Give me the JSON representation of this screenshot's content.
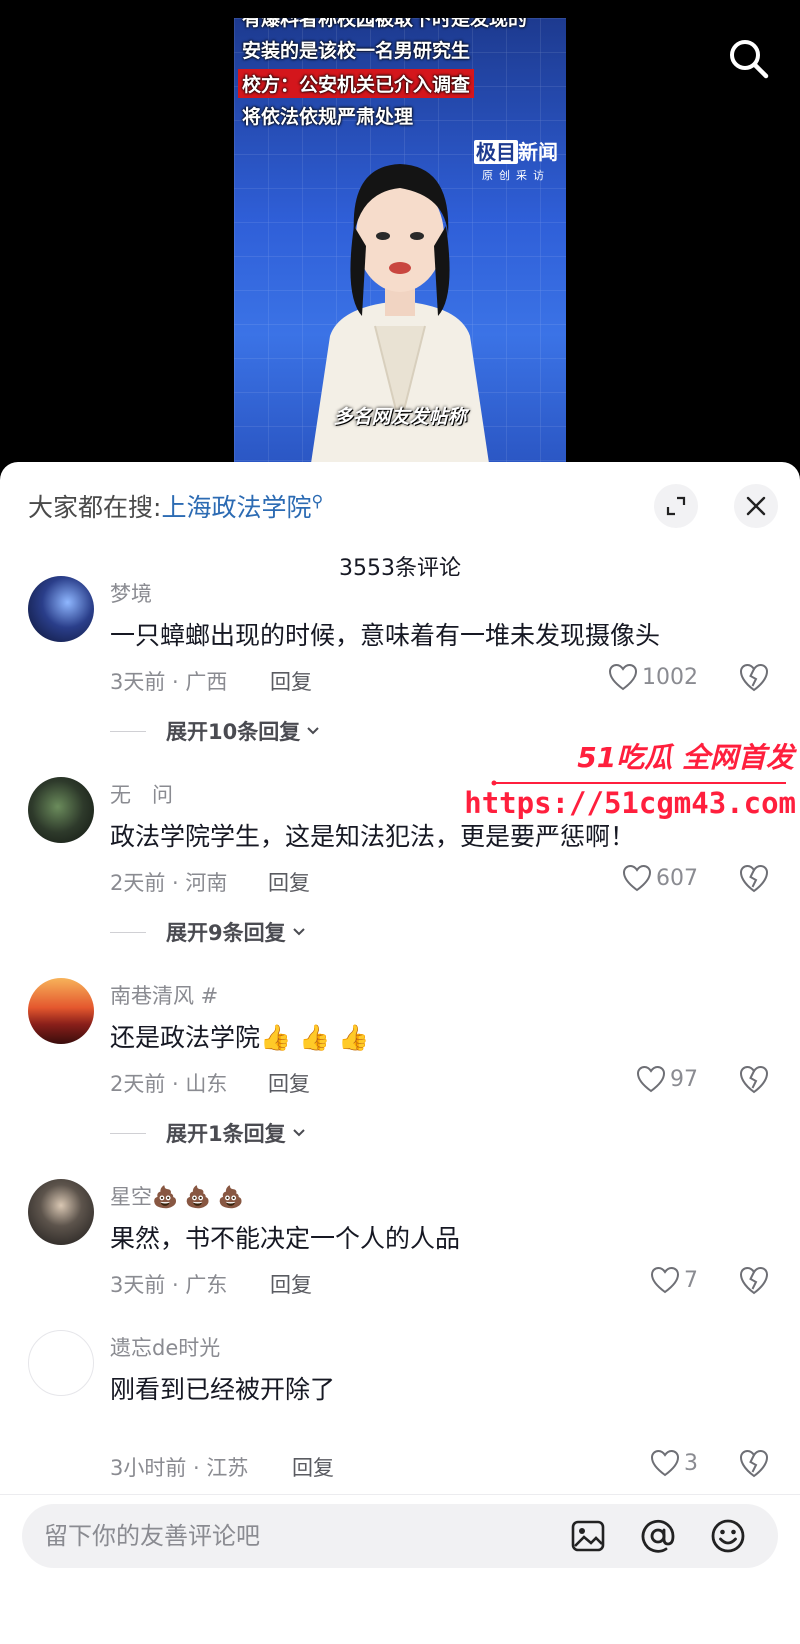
{
  "video": {
    "captions": [
      "有爆料者称校园被取下时是发现的",
      "安装的是该校一名男研究生",
      "校方：公安机关已介入调查",
      "将依法依规严肃处理"
    ],
    "logo_brand_box": "极目",
    "logo_brand_rest": "新闻",
    "logo_sub": "原创采访",
    "subtitle": "多名网友发帖称"
  },
  "sheet": {
    "hot_search_prefix": "大家都在搜:",
    "hot_search_keyword": "上海政法学院",
    "comment_count": "3553条评论"
  },
  "comments": [
    {
      "username": "梦境",
      "content": "一只蟑螂出现的时候，意味着有一堆未发现摄像头",
      "meta": "3天前 · 广西",
      "reply": "回复",
      "likes": "1002",
      "expand": "展开10条回复"
    },
    {
      "username": "无　问",
      "content": "政法学院学生，这是知法犯法，更是要严惩啊！",
      "meta": "2天前 · 河南",
      "reply": "回复",
      "likes": "607",
      "expand": "展开9条回复"
    },
    {
      "username": "南巷清风 #",
      "content": "还是政法学院👍 👍 👍",
      "meta": "2天前 · 山东",
      "reply": "回复",
      "likes": "97",
      "expand": "展开1条回复"
    },
    {
      "username": "星空💩 💩 💩",
      "content": "果然，书不能决定一个人的人品",
      "meta": "3天前 · 广东",
      "reply": "回复",
      "likes": "7"
    },
    {
      "username": "遗忘de时光",
      "content": "刚看到已经被开除了",
      "meta": "3小时前 · 江苏",
      "reply": "回复",
      "likes": "3"
    }
  ],
  "watermark": {
    "top": "51吃瓜 全网首发",
    "url": "https://51cgm43.com"
  },
  "input": {
    "placeholder": "留下你的友善评论吧"
  },
  "colors": {
    "keyword": "#2c6bb3",
    "watermark": "#ff1f3d",
    "caption_highlight": "#d4161c"
  },
  "icons": [
    "search-icon",
    "expand-icon",
    "close-icon",
    "heart-icon",
    "broken-heart-icon",
    "image-icon",
    "at-icon",
    "emoji-icon"
  ]
}
